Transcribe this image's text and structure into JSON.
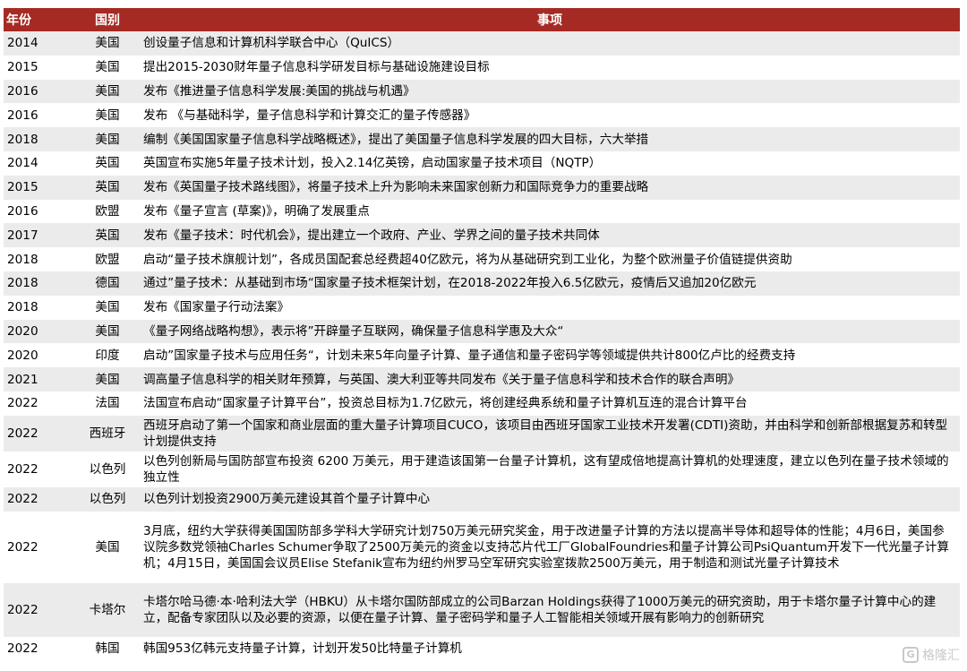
{
  "header": {
    "year": "年份",
    "country": "国别",
    "event": "事项"
  },
  "rows": [
    {
      "year": "2014",
      "country": "美国",
      "event": "创设量子信息和计算机科学联合中心（QuICS）"
    },
    {
      "year": "2015",
      "country": "美国",
      "event": "提出2015-2030财年量子信息科学研发目标与基础设施建设目标"
    },
    {
      "year": "2016",
      "country": "美国",
      "event": "发布《推进量子信息科学发展:美国的挑战与机遇》"
    },
    {
      "year": "2016",
      "country": "美国",
      "event": "发布 《与基础科学，量子信息科学和计算交汇的量子传感器》"
    },
    {
      "year": "2018",
      "country": "美国",
      "event": "编制《美国国家量子信息科学战略概述》，提出了美国量子信息科学发展的四大目标，六大举措"
    },
    {
      "year": "2014",
      "country": "英国",
      "event": "英国宣布实施5年量子技术计划，投入2.14亿英镑，启动国家量子技术项目（NQTP）"
    },
    {
      "year": "2015",
      "country": "英国",
      "event": "发布《英国量子技术路线图》，将量子技术上升为影响未来国家创新力和国际竞争力的重要战略"
    },
    {
      "year": "2016",
      "country": "欧盟",
      "event": "发布《量子宣言 (草案)》，明确了发展重点"
    },
    {
      "year": "2017",
      "country": "英国",
      "event": "发布《量子技术：时代机会》，提出建立一个政府、产业、学界之间的量子技术共同体"
    },
    {
      "year": "2018",
      "country": "欧盟",
      "event": "启动“量子技术旗舰计划”，各成员国配套总经费超40亿欧元，将为从基础研究到工业化，为整个欧洲量子价值链提供资助"
    },
    {
      "year": "2018",
      "country": "德国",
      "event": "通过”量子技术：从基础到市场“国家量子技术框架计划，在2018-2022年投入6.5亿欧元，疫情后又追加20亿欧元"
    },
    {
      "year": "2018",
      "country": "美国",
      "event": "发布《国家量子行动法案》"
    },
    {
      "year": "2020",
      "country": "美国",
      "event": "《量子网络战略构想》，表示将”开辟量子互联网，确保量子信息科学惠及大众“"
    },
    {
      "year": "2020",
      "country": "印度",
      "event": "启动”国家量子技术与应用任务“，计划未来5年向量子计算、量子通信和量子密码学等领域提供共计800亿卢比的经费支持"
    },
    {
      "year": "2021",
      "country": "美国",
      "event": "调高量子信息科学的相关财年预算，与英国、澳大利亚等共同发布《关于量子信息科学和技术合作的联合声明》"
    },
    {
      "year": "2022",
      "country": "法国",
      "event": "法国宣布启动“国家量子计算平台”，投资总目标为1.7亿欧元，将创建经典系统和量子计算机互连的混合计算平台"
    },
    {
      "year": "2022",
      "country": "西班牙",
      "event": "西班牙启动了第一个国家和商业层面的重大量子计算项目CUCO，该项目由西班牙国家工业技术开发署(CDTI)资助，并由科学和创新部根据复苏和转型计划提供支持"
    },
    {
      "year": "2022",
      "country": "以色列",
      "event": "以色列创新局与国防部宣布投资 6200 万美元，用于建造该国第一台量子计算机，这有望成倍地提高计算机的处理速度，建立以色列在量子技术领域的独立性"
    },
    {
      "year": "2022",
      "country": "以色列",
      "event": "以色列计划投资2900万美元建设其首个量子计算中心"
    },
    {
      "year": "2022",
      "country": "美国",
      "event": "3月底，纽约大学获得美国国防部多学科大学研究计划750万美元研究奖金，用于改进量子计算的方法以提高半导体和超导体的性能；4月6日，美国参议院多数党领袖Charles Schumer争取了2500万美元的资金以支持芯片代工厂GlobalFoundries和量子计算公司PsiQuantum开发下一代光量子计算机；4月15日，美国国会议员Elise Stefanik宣布为纽约州罗马空军研究实验室拨款2500万美元，用于制造和测试光量子计算技术"
    },
    {
      "year": "2022",
      "country": "卡塔尔",
      "event": "卡塔尔哈马德·本·哈利法大学（HBKU）从卡塔尔国防部成立的公司Barzan Holdings获得了1000万美元的研究资助，用于卡塔尔量子计算中心的建立，配备专家团队以及必要的资源，以便在量子计算、量子密码学和量子人工智能相关领域开展有影响力的创新研究"
    },
    {
      "year": "2022",
      "country": "韩国",
      "event": "韩国953亿韩元支持量子计算，计划开发50比特量子计算机"
    }
  ],
  "watermark": {
    "icon": "gelonghui-logo-icon",
    "text": "格隆汇"
  }
}
